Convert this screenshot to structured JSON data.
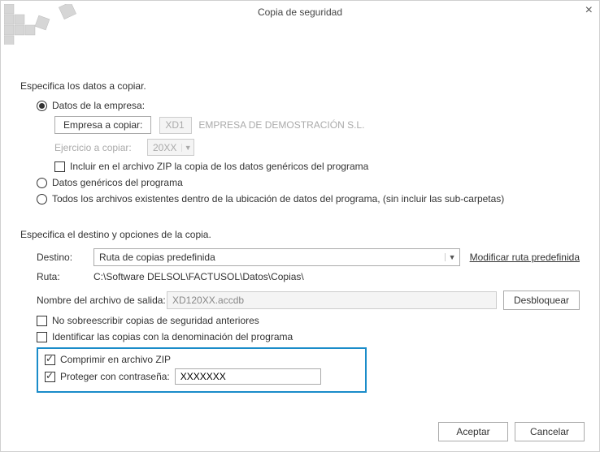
{
  "title": "Copia de seguridad",
  "section1": {
    "title": "Especifica los datos a copiar.",
    "opt_company": "Datos de la empresa:",
    "btn_company": "Empresa a copiar:",
    "company_code": "XD1",
    "company_name": "EMPRESA DE DEMOSTRACIÓN S.L.",
    "lbl_year": "Ejercicio a copiar:",
    "year_value": "20XX",
    "chk_include_generic": "Incluir en el archivo ZIP la copia de los datos genéricos del programa",
    "opt_generic": "Datos genéricos del programa",
    "opt_all": "Todos los archivos existentes dentro de la ubicación de datos del programa, (sin incluir las sub-carpetas)"
  },
  "section2": {
    "title": "Especifica el destino y opciones de la copia.",
    "lbl_dest": "Destino:",
    "dest_value": "Ruta de copias predefinida",
    "link_modify": "Modificar ruta predefinida",
    "lbl_path": "Ruta:",
    "path_value": "C:\\Software DELSOL\\FACTUSOL\\Datos\\Copias\\",
    "lbl_outname": "Nombre del archivo de salida:",
    "outname_value": "XD120XX.accdb",
    "btn_unlock": "Desbloquear",
    "chk_no_overwrite": "No sobreescribir copias de seguridad anteriores",
    "chk_identify": "Identificar las copias con la denominación del programa",
    "chk_zip": "Comprimir en archivo ZIP",
    "chk_pwd": "Proteger con contraseña:",
    "pwd_value": "XXXXXXX"
  },
  "footer": {
    "accept": "Aceptar",
    "cancel": "Cancelar"
  }
}
